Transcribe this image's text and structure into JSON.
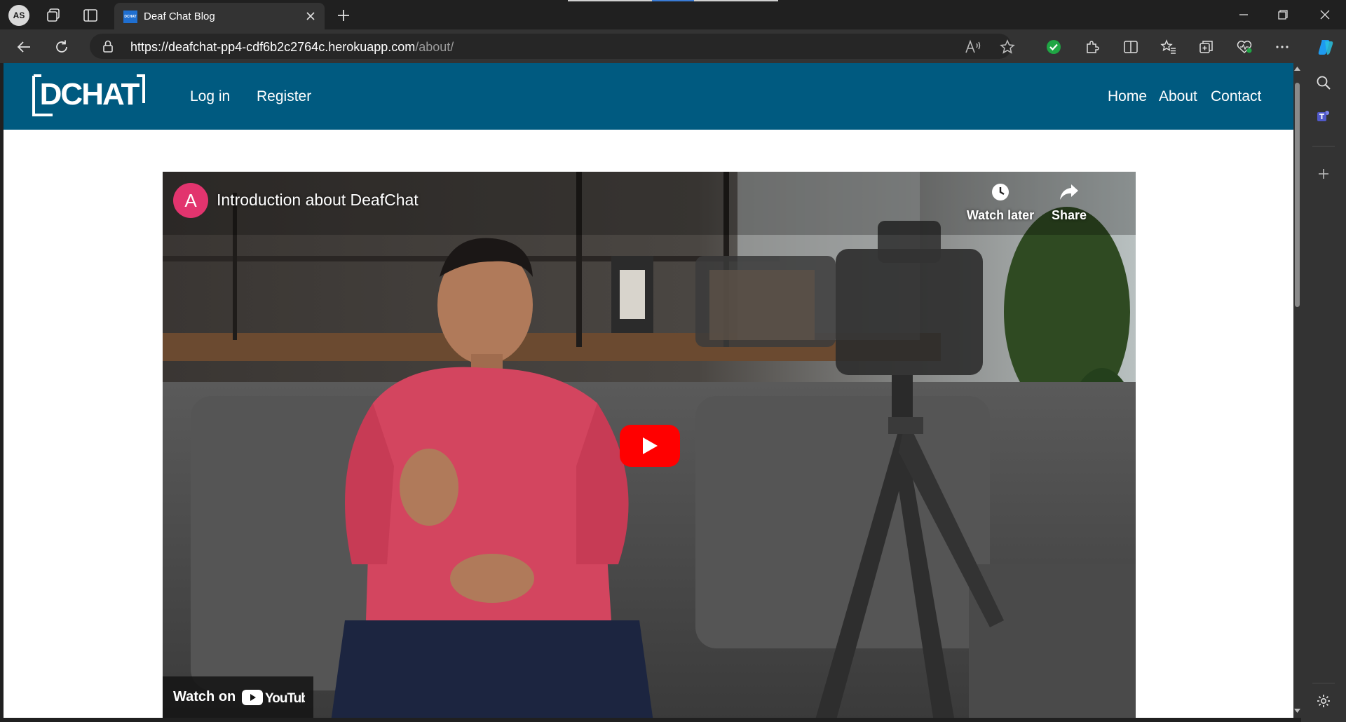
{
  "browser": {
    "profile_initials": "AS",
    "tab": {
      "title": "Deaf Chat Blog",
      "favicon_text": "DCHAT"
    },
    "url": {
      "host": "https://deafchat-pp4-cdf6b2c2764c.herokuapp.com",
      "path": "/about/"
    }
  },
  "site": {
    "logo_text": "DCHAT",
    "nav_left": [
      {
        "label": "Log in"
      },
      {
        "label": "Register"
      }
    ],
    "nav_right": [
      {
        "label": "Home"
      },
      {
        "label": "About"
      },
      {
        "label": "Contact"
      }
    ],
    "brand_color": "#005a80"
  },
  "video": {
    "channel_initial": "A",
    "title": "Introduction about DeafChat",
    "watch_later_label": "Watch later",
    "share_label": "Share",
    "watch_on_label": "Watch on",
    "youtube_label": "YouTube",
    "play_color": "#ff0000"
  }
}
